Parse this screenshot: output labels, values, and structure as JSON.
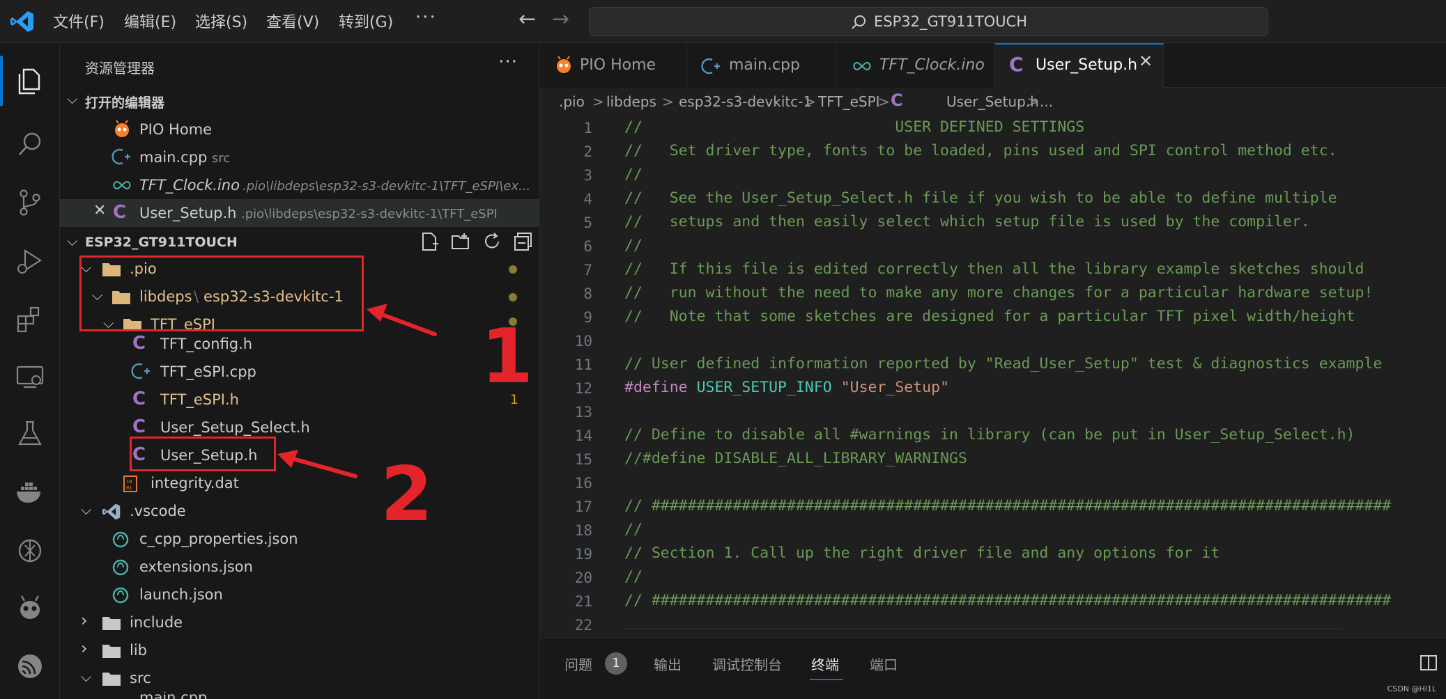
{
  "titlebar": {
    "menus": [
      "文件(F)",
      "编辑(E)",
      "选择(S)",
      "查看(V)",
      "转到(G)",
      "···"
    ],
    "search_text": "ESP32_GT911TOUCH"
  },
  "sidebar": {
    "title": "资源管理器",
    "more": "···",
    "open_editors": {
      "header": "打开的编辑器",
      "items": [
        {
          "label": "PIO Home",
          "desc": ""
        },
        {
          "label": "main.cpp",
          "desc": "src"
        },
        {
          "label": "TFT_Clock.ino",
          "desc": ".pio\\libdeps\\esp32-s3-devkitc-1\\TFT_eSPI\\ex..."
        },
        {
          "label": "User_Setup.h",
          "desc": ".pio\\libdeps\\esp32-s3-devkitc-1\\TFT_eSPI"
        }
      ]
    },
    "workspace": {
      "header": "ESP32_GT911TOUCH",
      "tree": {
        "pio": ".pio",
        "libdeps": "libdeps",
        "sep": "\\",
        "board": "esp32-s3-devkitc-1",
        "tft_espi": "TFT_eSPI",
        "tft_config": "TFT_config.h",
        "tft_espi_cpp": "TFT_eSPI.cpp",
        "tft_espi_h": "TFT_eSPI.h",
        "tft_espi_h_badge": "1",
        "user_setup_select": "User_Setup_Select.h",
        "user_setup": "User_Setup.h",
        "integrity": "integrity.dat",
        "vscode": ".vscode",
        "c_cpp": "c_cpp_properties.json",
        "extensions": "extensions.json",
        "launch": "launch.json",
        "include": "include",
        "lib": "lib",
        "src": "src",
        "main_partial": "main.cpp"
      }
    }
  },
  "tabs": [
    {
      "label": "PIO Home"
    },
    {
      "label": "main.cpp"
    },
    {
      "label": "TFT_Clock.ino"
    },
    {
      "label": "User_Setup.h",
      "close": "✕"
    }
  ],
  "breadcrumb": [
    ".pio",
    "libdeps",
    "esp32-s3-devkitc-1",
    "TFT_eSPI",
    "User_Setup.h",
    "..."
  ],
  "breadcrumb_sep": ">",
  "code": {
    "line_numbers": [
      "1",
      "2",
      "3",
      "4",
      "5",
      "6",
      "7",
      "8",
      "9",
      "10",
      "11",
      "12",
      "13",
      "14",
      "15",
      "16",
      "17",
      "18",
      "19",
      "20",
      "21",
      "22"
    ],
    "l1": "//                            USER DEFINED SETTINGS",
    "l2": "//   Set driver type, fonts to be loaded, pins used and SPI control method etc.",
    "l3": "//",
    "l4": "//   See the User_Setup_Select.h file if you wish to be able to define multiple",
    "l5": "//   setups and then easily select which setup file is used by the compiler.",
    "l6": "//",
    "l7": "//   If this file is edited correctly then all the library example sketches should",
    "l8": "//   run without the need to make any more changes for a particular hardware setup!",
    "l9": "//   Note that some sketches are designed for a particular TFT pixel width/height",
    "l10": "",
    "l11": "// User defined information reported by \"Read_User_Setup\" test & diagnostics example",
    "l12_kw": "#define",
    "l12_mac": "USER_SETUP_INFO",
    "l12_str": "\"User_Setup\"",
    "l13": "",
    "l14": "// Define to disable all #warnings in library (can be put in User_Setup_Select.h)",
    "l15": "//#define DISABLE_ALL_LIBRARY_WARNINGS",
    "l16": "",
    "l17": "// ##################################################################################",
    "l18": "//",
    "l19": "// Section 1. Call up the right driver file and any options for it",
    "l20": "//",
    "l21": "// ##################################################################################",
    "l22": ""
  },
  "panel": {
    "tabs": [
      "问题",
      "输出",
      "调试控制台",
      "终端",
      "端口"
    ],
    "problems_count": "1",
    "watermark": "CSDN @Hi1L"
  },
  "annotations": {
    "one": "1",
    "two": "2"
  },
  "colors": {
    "accent": "#0078d4",
    "annotation": "#e3242b",
    "modified": "#e2c08d"
  }
}
